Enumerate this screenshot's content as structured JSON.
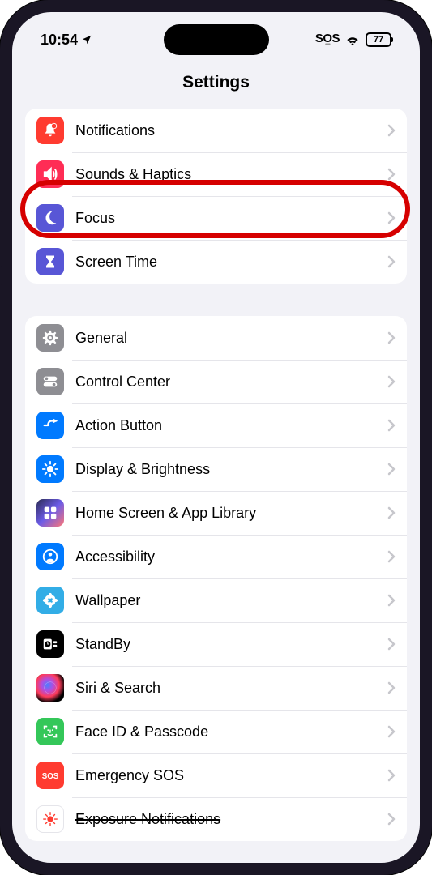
{
  "statusBar": {
    "time": "10:54",
    "sos": "SOS",
    "battery": "77"
  },
  "title": "Settings",
  "group1": [
    {
      "label": "Notifications",
      "icon": "bell-badge-icon",
      "bg": "bg-red"
    },
    {
      "label": "Sounds & Haptics",
      "icon": "speaker-icon",
      "bg": "bg-pink"
    },
    {
      "label": "Focus",
      "icon": "moon-icon",
      "bg": "bg-indigo"
    },
    {
      "label": "Screen Time",
      "icon": "hourglass-icon",
      "bg": "bg-indigo"
    }
  ],
  "group2": [
    {
      "label": "General",
      "icon": "gear-icon",
      "bg": "bg-gray"
    },
    {
      "label": "Control Center",
      "icon": "toggles-icon",
      "bg": "bg-gray"
    },
    {
      "label": "Action Button",
      "icon": "action-icon",
      "bg": "bg-blue"
    },
    {
      "label": "Display & Brightness",
      "icon": "sun-icon",
      "bg": "bg-blue"
    },
    {
      "label": "Home Screen & App Library",
      "icon": "grid-icon",
      "bg": "bg-purple-grad"
    },
    {
      "label": "Accessibility",
      "icon": "person-icon",
      "bg": "bg-blue"
    },
    {
      "label": "Wallpaper",
      "icon": "flower-icon",
      "bg": "bg-cyan"
    },
    {
      "label": "StandBy",
      "icon": "clock-icon",
      "bg": "bg-black"
    },
    {
      "label": "Siri & Search",
      "icon": "siri-icon",
      "bg": "bg-siri"
    },
    {
      "label": "Face ID & Passcode",
      "icon": "face-icon",
      "bg": "bg-green"
    },
    {
      "label": "Emergency SOS",
      "icon": "sos-icon",
      "bg": "bg-red"
    },
    {
      "label": "Exposure Notifications",
      "icon": "exposure-icon",
      "bg": "bg-white-red",
      "strike": true
    }
  ],
  "highlightIndex": 1
}
